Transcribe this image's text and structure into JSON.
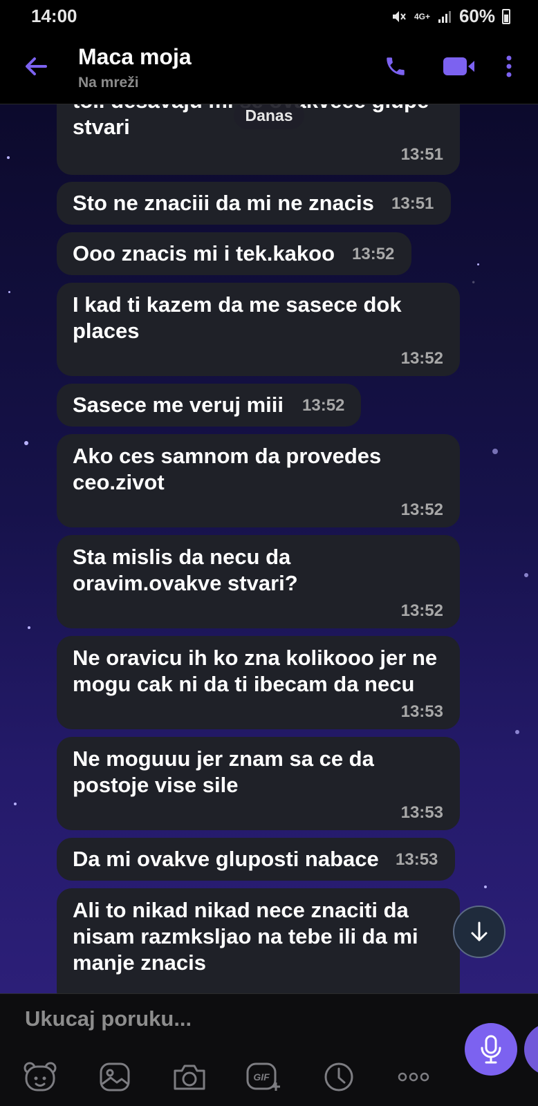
{
  "status_bar": {
    "time": "14:00",
    "network": "4G+",
    "battery": "60%"
  },
  "header": {
    "contact_name": "Maca moja",
    "status": "Na mreži"
  },
  "date_separator": "Danas",
  "messages": [
    {
      "text_lines": [
        "to.. desavaju mi se ovakveee glupe",
        "stvari"
      ],
      "time": "13:51"
    },
    {
      "text_lines": [
        "Sto ne znaciii da mi ne znacis"
      ],
      "time": "13:51"
    },
    {
      "text_lines": [
        "Ooo znacis mi i tek.kakoo"
      ],
      "time": "13:52"
    },
    {
      "text_lines": [
        "I kad ti kazem da me sasece dok",
        "places"
      ],
      "time": "13:52"
    },
    {
      "text_lines": [
        "Sasece me veruj miii"
      ],
      "time": "13:52"
    },
    {
      "text_lines": [
        "Ako ces samnom da provedes",
        "ceo.zivot"
      ],
      "time": "13:52"
    },
    {
      "text_lines": [
        "Sta mislis da necu da",
        "oravim.ovakve stvari?"
      ],
      "time": "13:52"
    },
    {
      "text_lines": [
        "Ne oravicu ih ko zna kolikooo jer ne",
        "mogu cak ni da ti ibecam da necu"
      ],
      "time": "13:53"
    },
    {
      "text_lines": [
        "Ne moguuu jer znam sa ce da",
        "postoje vise sile"
      ],
      "time": "13:53"
    },
    {
      "text_lines": [
        "Da mi ovakve gluposti nabace"
      ],
      "time": "13:53"
    },
    {
      "text_lines": [
        "Ali to nikad nikad nece znaciti da",
        "nisam razmksljao na tebe ili da mi",
        "manje znacis"
      ],
      "time": ""
    }
  ],
  "compose": {
    "placeholder": "Ukucaj poruku..."
  },
  "icons": {
    "back": "arrow-left-icon",
    "call": "phone-icon",
    "video": "video-camera-icon",
    "more": "more-vertical-icon",
    "scroll": "arrow-down-icon",
    "sticker": "bear-sticker-icon",
    "gallery": "gallery-icon",
    "camera": "camera-icon",
    "gif": "gif-icon",
    "timer": "clock-icon",
    "more_tools": "more-horizontal-icon",
    "mic": "microphone-icon"
  },
  "colors": {
    "accent": "#7c62f0",
    "bubble": "#1f2128",
    "time": "#a8a8a8"
  }
}
